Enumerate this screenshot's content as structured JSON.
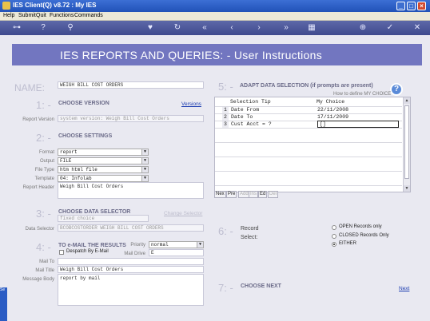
{
  "titlebar": {
    "title": "IES Client(Q) v8.72 : My IES"
  },
  "menu": [
    "Help",
    "Submit",
    "Quit",
    "Functions",
    "Commands"
  ],
  "banner": {
    "title": "IES REPORTS AND QUERIES: -   User Instructions"
  },
  "name": {
    "label": "NAME:",
    "value": "WEIGH BILL COST ORDERS"
  },
  "s1": {
    "num": "1: -",
    "title": "CHOOSE VERSION",
    "versions_link": "Versions",
    "rv_label": "Report Version",
    "rv_value": "system version: Weigh Bill Cost Orders"
  },
  "s2": {
    "num": "2: -",
    "title": "CHOOSE SETTINGS",
    "format_label": "Format",
    "format_value": "report",
    "output_label": "Output",
    "output_value": "FILE",
    "filetype_label": "File Type",
    "filetype_value": "htm html file",
    "template_label": "Template",
    "template_value": "04: Infolab",
    "header_label": "Report Header",
    "header_value": "Weigh Bill Cost Orders"
  },
  "s3": {
    "num": "3: -",
    "title": "CHOOSE DATA SELECTOR",
    "choice_value": "fixed choice",
    "change_link": "Change Selector",
    "ds_label": "Data Selector",
    "ds_value": "BCOBCOSTORDER WEIGH BILL COST ORDERS"
  },
  "s4": {
    "num": "4: -",
    "title": "TO e-MAIL THE RESULTS",
    "despatch_label": "Despatch By E-Mail",
    "priority_label": "Priority",
    "priority_value": "normal",
    "maildrive_label": "Mail Drive",
    "maildrive_value": "E",
    "mailto_label": "Mail To",
    "mailto_value": "",
    "mailtitle_label": "Mail Title",
    "mailtitle_value": "Weigh Bill Cost Orders",
    "body_label": "Message Body",
    "body_value": "report by mail"
  },
  "s5": {
    "num": "5: -",
    "title": "ADAPT DATA SELECTION (if prompts are present)",
    "howto_link": "How to define MY CHOICE",
    "col_tip": "Selection Tip",
    "col_choice": "My Choice",
    "rows": [
      {
        "n": "1",
        "tip": "Date From",
        "choice": "22/11/2008"
      },
      {
        "n": "2",
        "tip": "Date To",
        "choice": "17/11/2009"
      },
      {
        "n": "3",
        "tip": "Cust Acct = ?",
        "choice": "[]"
      }
    ],
    "nav": [
      "Nex",
      "Pre",
      "Add",
      "Ins",
      "Ed",
      "Del"
    ]
  },
  "s6": {
    "num": "6: -",
    "record_label": "Record",
    "select_label": "Select:",
    "options": [
      "OPEN Records only",
      "CLOSED Records Only",
      "EITHER"
    ],
    "selected": 2
  },
  "s7": {
    "num": "7: -",
    "title": "CHOOSE NEXT",
    "next_link": "Next"
  },
  "help_glyph": "?",
  "taskstub": "Se"
}
